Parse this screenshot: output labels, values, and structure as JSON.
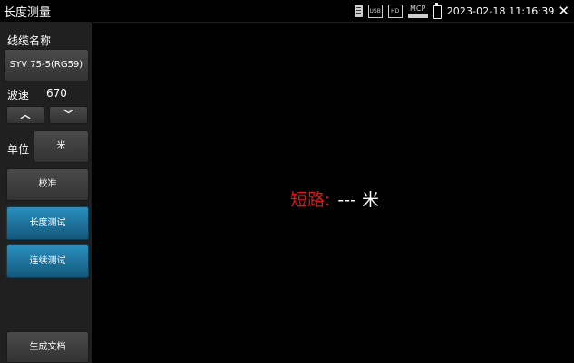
{
  "header": {
    "title": "长度测量",
    "status_icons": [
      {
        "name": "sd-card-icon"
      },
      {
        "name": "usb-storage-icon",
        "text": "USB"
      },
      {
        "name": "screenshot-icon",
        "text": "HD"
      },
      {
        "name": "mcp-icon",
        "text": "MCP"
      },
      {
        "name": "battery-icon"
      }
    ],
    "datetime": "2023-02-18 11:16:39",
    "close_glyph": "✕"
  },
  "sidebar": {
    "cable_name_label": "线缆名称",
    "cable_name_value": "SYV 75-5(RG59)",
    "velocity_label": "波速",
    "velocity_value": "670",
    "up_glyph": "︿",
    "down_glyph": "﹀",
    "unit_label": "单位",
    "unit_value": "米",
    "calibrate_label": "校准",
    "length_test_label": "长度测试",
    "continuous_test_label": "连续测试",
    "generate_doc_label": "生成文档"
  },
  "main": {
    "result_label": "短路:",
    "result_value": "---",
    "result_unit": "米"
  },
  "colors": {
    "accent_blue": "#1f7fae",
    "alert_red": "#e01515",
    "background": "#000000"
  }
}
